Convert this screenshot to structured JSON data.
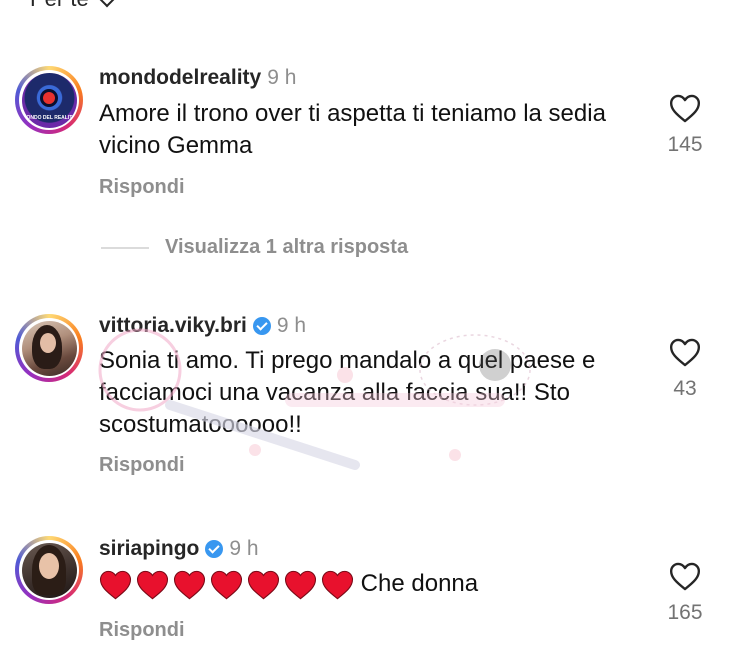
{
  "sort": {
    "label": "Per te"
  },
  "reply_label": "Rispondi",
  "view_replies": {
    "label": "Visualizza 1 altra risposta"
  },
  "comments": [
    {
      "username": "mondodelreality",
      "verified": false,
      "time": "9 h",
      "text": "Amore il trono over ti aspetta ti teniamo la sedia vicino Gemma",
      "likes": "145",
      "avatar_caption": "MONDO DEL REALITY"
    },
    {
      "username": "vittoria.viky.bri",
      "verified": true,
      "time": "9 h",
      "text": "Sonia ti amo. Ti prego mandalo a quel paese e facciamoci una vacanza alla faccia sua!! Sto scostumatoooooo!!",
      "likes": "43"
    },
    {
      "username": "siriapingo",
      "verified": true,
      "time": "9 h",
      "heart_emoji_count": 7,
      "text": "Che donna",
      "likes": "165"
    }
  ],
  "colors": {
    "heart_emoji": "#e8112d",
    "verified": "#3897f0",
    "muted": "#8e8e8e"
  }
}
